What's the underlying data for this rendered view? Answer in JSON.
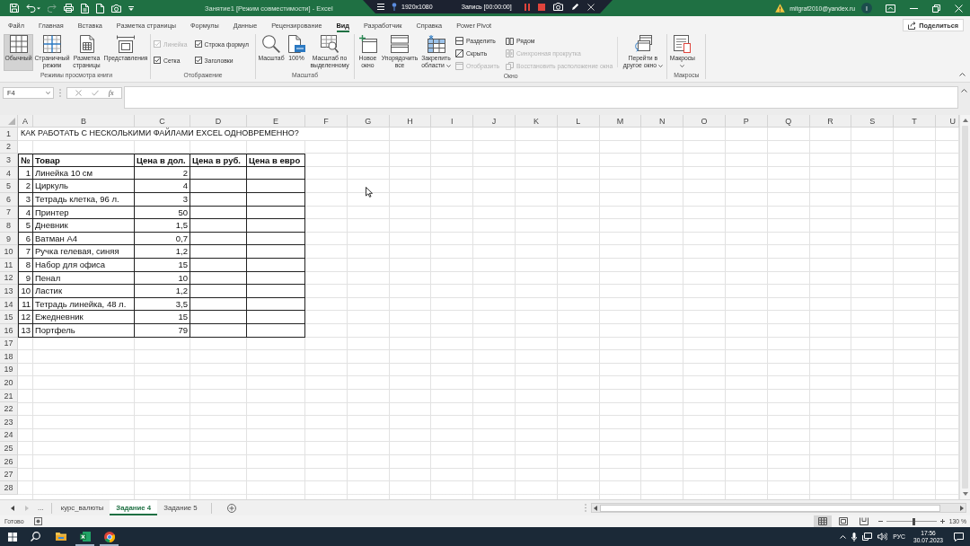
{
  "title_bar": {
    "quick_access": [
      {
        "disabled": false
      },
      {
        "disabled": false
      },
      {
        "disabled": true
      },
      {
        "disabled": false
      },
      {
        "disabled": false
      },
      {
        "disabled": false
      },
      {
        "disabled": false
      },
      {
        "disabled": false
      }
    ],
    "title": "Занятие1 [Режим совместимости] - Excel",
    "account": "mitgraf2010@yandex.ru",
    "avatar": "I"
  },
  "recorder": {
    "resolution": "1920x1080",
    "status": "Запись [00:00:00]"
  },
  "ribbon": {
    "tabs": [
      {
        "label": "Файл",
        "selected": false
      },
      {
        "label": "Главная",
        "selected": false
      },
      {
        "label": "Вставка",
        "selected": false
      },
      {
        "label": "Разметка страницы",
        "selected": false
      },
      {
        "label": "Формулы",
        "selected": false
      },
      {
        "label": "Данные",
        "selected": false
      },
      {
        "label": "Рецензирование",
        "selected": false
      },
      {
        "label": "Вид",
        "selected": true
      },
      {
        "label": "Разработчик",
        "selected": false
      },
      {
        "label": "Справка",
        "selected": false
      },
      {
        "label": "Power Pivot",
        "selected": false
      }
    ],
    "share": "Поделиться",
    "groups": [
      {
        "label": "Режимы просмотра книги",
        "items": [
          {
            "kind": "large",
            "label": "Обычный",
            "selected": true
          },
          {
            "kind": "large",
            "label": "Страничный режим",
            "selected": false
          },
          {
            "kind": "large",
            "label": "Разметка страницы",
            "selected": false
          },
          {
            "kind": "large",
            "label": "Представления",
            "selected": false
          }
        ]
      },
      {
        "label": "Отображение",
        "items": [
          {
            "kind": "check",
            "label": "Линейка",
            "checked": true,
            "disabled": true
          },
          {
            "kind": "check",
            "label": "Сетка",
            "checked": true,
            "disabled": false
          },
          {
            "kind": "check",
            "label": "Строка формул",
            "checked": true,
            "disabled": false
          },
          {
            "kind": "check",
            "label": "Заголовки",
            "checked": true,
            "disabled": false
          }
        ]
      },
      {
        "label": "Масштаб",
        "items": [
          {
            "kind": "large",
            "label": "Масштаб"
          },
          {
            "kind": "large",
            "label": "100%"
          },
          {
            "kind": "large",
            "label": "Масштаб по выделенному"
          }
        ]
      },
      {
        "label": "Окно",
        "items": [
          {
            "kind": "large",
            "label": "Новое окно"
          },
          {
            "kind": "large",
            "label": "Упорядочить все"
          },
          {
            "kind": "large",
            "label": "Закрепить области",
            "dropdown": true
          },
          {
            "kind": "small",
            "label": "Разделить",
            "disabled": false
          },
          {
            "kind": "small",
            "label": "Скрыть",
            "disabled": false
          },
          {
            "kind": "small",
            "label": "Отобразить",
            "disabled": true
          },
          {
            "kind": "small",
            "label": "Рядом",
            "disabled": false
          },
          {
            "kind": "small",
            "label": "Синхронная прокрутка",
            "disabled": true
          },
          {
            "kind": "small",
            "label": "Восстановить расположение окна",
            "disabled": true
          },
          {
            "kind": "large",
            "label": "Перейти в другое окно",
            "dropdown": true
          }
        ]
      },
      {
        "label": "Макросы",
        "items": [
          {
            "kind": "large",
            "label": "Макросы",
            "dropdown": true
          }
        ]
      }
    ]
  },
  "formula_bar": {
    "name_box": "F4",
    "function": "fx"
  },
  "sheet": {
    "columns": [
      "A",
      "B",
      "C",
      "D",
      "E",
      "F",
      "G",
      "H",
      "I",
      "J",
      "K",
      "L",
      "M",
      "N",
      "O",
      "P",
      "Q",
      "R",
      "S",
      "T",
      "U"
    ],
    "rows": [
      "1",
      "2",
      "3",
      "4",
      "5",
      "6",
      "7",
      "8",
      "9",
      "10",
      "11",
      "12",
      "13",
      "14",
      "15",
      "16",
      "17",
      "18",
      "19",
      "20",
      "21",
      "22",
      "23",
      "24",
      "25",
      "26",
      "27",
      "28"
    ],
    "title": "КАК РАБОТАТЬ С НЕСКОЛЬКИМИ ФАЙЛАМИ EXCEL ОДНОВРЕМЕННО?",
    "table": {
      "header": [
        "№",
        "Товар",
        "Цена в дол.",
        "Цена в руб.",
        "Цена в евро"
      ],
      "rows": [
        [
          "1",
          "Линейка 10 см",
          "2"
        ],
        [
          "2",
          "Циркуль",
          "4"
        ],
        [
          "3",
          "Тетрадь клетка, 96 л.",
          "3"
        ],
        [
          "4",
          "Принтер",
          "50"
        ],
        [
          "5",
          "Дневник",
          "1,5"
        ],
        [
          "6",
          "Ватман А4",
          "0,7"
        ],
        [
          "7",
          "Ручка гелевая, синяя",
          "1,2"
        ],
        [
          "8",
          "Набор для офиса",
          "15"
        ],
        [
          "9",
          "Пенал",
          "10"
        ],
        [
          "10",
          "Ластик",
          "1,2"
        ],
        [
          "11",
          "Тетрадь линейка, 48 л.",
          "3,5"
        ],
        [
          "12",
          "Ежедневник",
          "15"
        ],
        [
          "13",
          "Портфель",
          "79"
        ]
      ]
    }
  },
  "sheet_tabs": {
    "overflow": "...",
    "tabs": [
      {
        "label": "курс_валюты",
        "selected": false
      },
      {
        "label": "Задание 4",
        "selected": true
      },
      {
        "label": "Задание 5",
        "selected": false
      }
    ]
  },
  "status_bar": {
    "status": "Готово",
    "views": [
      {
        "selected": true
      },
      {
        "selected": false
      },
      {
        "selected": false
      }
    ],
    "zoom": {
      "level": 0.55,
      "reading": "130 %"
    }
  },
  "taskbar": {
    "apps": [
      {
        "running": false
      },
      {
        "running": true
      },
      {
        "running": true
      }
    ],
    "language": "РУС",
    "time": "17:56",
    "date": "30.07.2023"
  }
}
